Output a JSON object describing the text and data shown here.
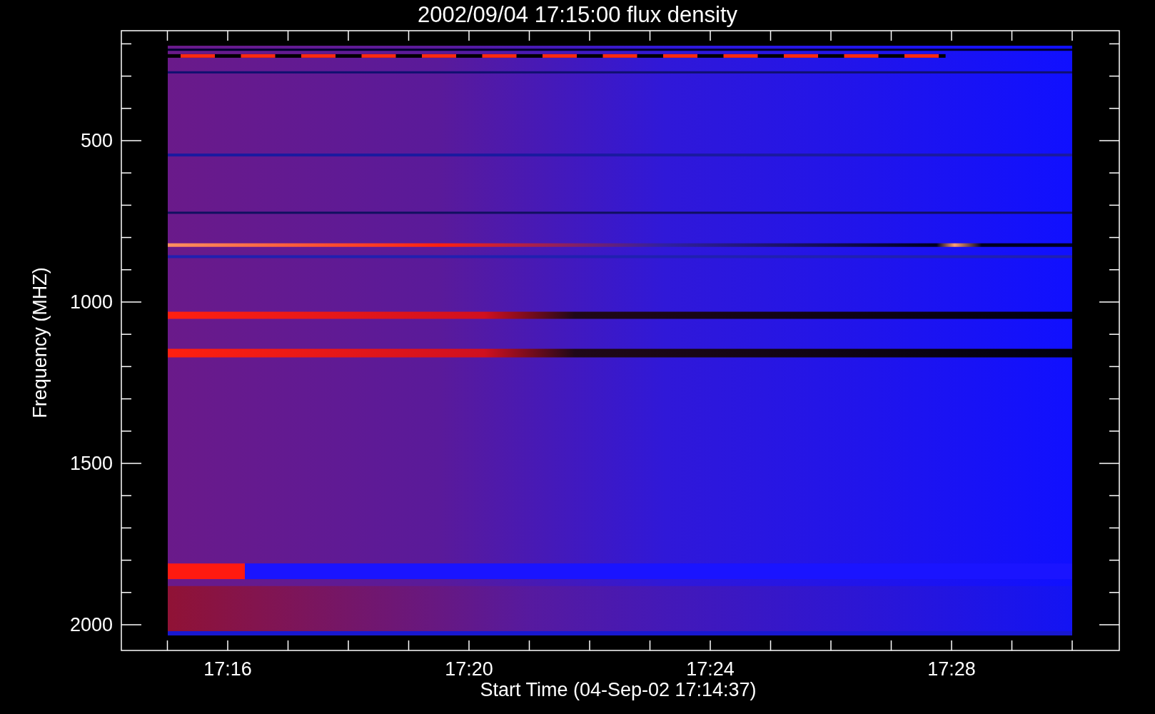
{
  "plot": {
    "title": "2002/09/04 17:15:00 flux density",
    "xlabel": "Start Time (04-Sep-02 17:14:37)",
    "ylabel": "Frequency (MHZ)",
    "xticks": [
      "17:16",
      "17:20",
      "17:24",
      "17:28"
    ],
    "yticks": [
      "500",
      "1000",
      "1500",
      "2000"
    ]
  }
}
